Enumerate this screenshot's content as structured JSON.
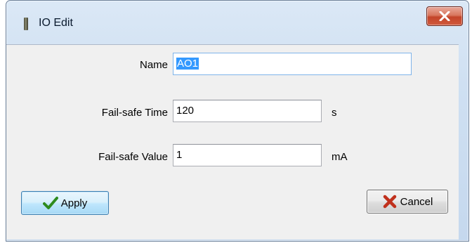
{
  "window": {
    "title": "IO Edit",
    "close_icon": "close-x-icon",
    "app_icon": "io-module-icon"
  },
  "form": {
    "name_label": "Name",
    "name_value": "AO1",
    "failsafe_time_label": "Fail-safe Time",
    "failsafe_time_value": "120",
    "failsafe_time_unit": "s",
    "failsafe_value_label": "Fail-safe Value",
    "failsafe_value_value": "1",
    "failsafe_value_unit": "mA"
  },
  "buttons": {
    "apply_label": "Apply",
    "apply_icon": "checkmark-icon",
    "cancel_label": "Cancel",
    "cancel_icon": "red-x-icon"
  },
  "colors": {
    "close_button": "#c4442a",
    "apply_border": "#3c7fb1",
    "checkmark": "#2e8b1e",
    "cancel_x": "#c0301c",
    "selection_highlight": "#3399ff"
  }
}
